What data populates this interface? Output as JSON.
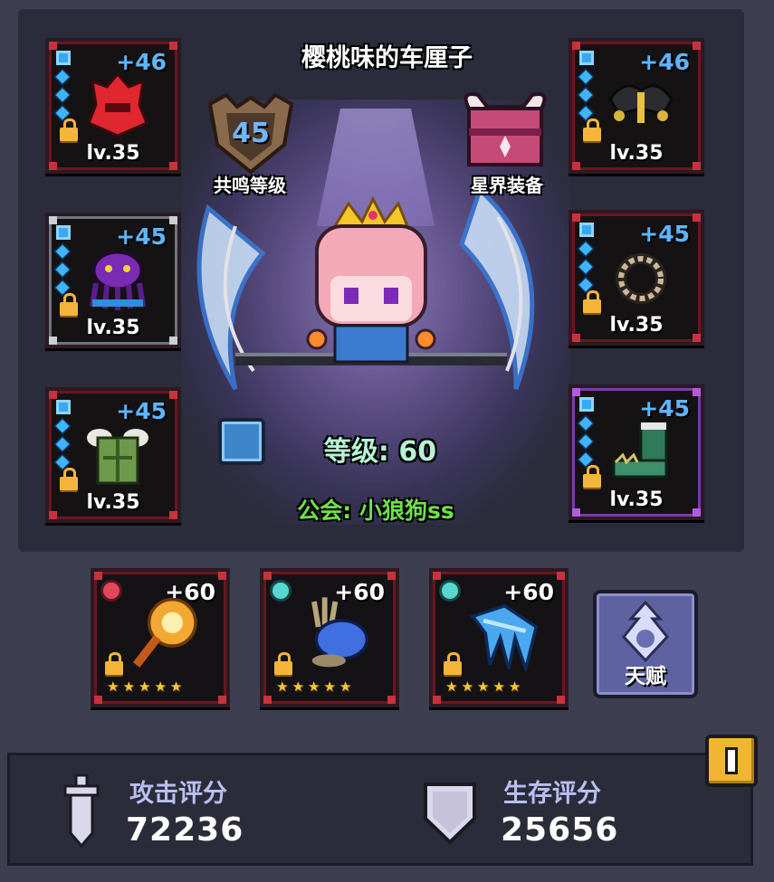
{
  "player": {
    "name": "樱桃味的车厘子",
    "level_text": "等级: 60",
    "guild_text": "公会: 小狼狗ss"
  },
  "badges": {
    "resonance": {
      "value": "45",
      "label": "共鸣等级",
      "icon": "resonance-crest-icon"
    },
    "astral": {
      "label": "星界装备",
      "icon": "astral-chest-icon"
    }
  },
  "equipment_left": [
    {
      "name": "helmet",
      "plus": "+46",
      "level": "lv.35",
      "icon": "red-helmet-icon",
      "frame": "red"
    },
    {
      "name": "pendant",
      "plus": "+45",
      "level": "lv.35",
      "icon": "purple-squid-amulet-icon",
      "frame": "gray"
    },
    {
      "name": "armor",
      "plus": "+45",
      "level": "lv.35",
      "icon": "green-armor-icon",
      "frame": "red"
    }
  ],
  "equipment_right": [
    {
      "name": "shoulder",
      "plus": "+46",
      "level": "lv.35",
      "icon": "dark-shoulder-guard-icon",
      "frame": "red"
    },
    {
      "name": "ring",
      "plus": "+45",
      "level": "lv.35",
      "icon": "ring-icon",
      "frame": "red"
    },
    {
      "name": "boots",
      "plus": "+45",
      "level": "lv.35",
      "icon": "green-boots-icon",
      "frame": "purple"
    }
  ],
  "weapons": [
    {
      "plus": "+60",
      "stars": "★★★★★",
      "icon": "golden-mace-icon",
      "element": "fire"
    },
    {
      "plus": "+60",
      "stars": "★★★★★",
      "icon": "blue-orb-staff-icon",
      "element": "ice"
    },
    {
      "plus": "+60",
      "stars": "★★★★★",
      "icon": "ice-claw-icon",
      "element": "ice"
    }
  ],
  "talent": {
    "label": "天赋",
    "icon": "talent-crest-icon"
  },
  "stats": {
    "attack": {
      "label": "攻击评分",
      "value": "72236",
      "icon": "sword-icon"
    },
    "survival": {
      "label": "生存评分",
      "value": "25656",
      "icon": "shield-icon"
    }
  },
  "colors": {
    "plus_blue": "#5eb6ff",
    "guild_green": "#6fe04a",
    "level_mint": "#b6f2d4",
    "frame_red": "#6b1620",
    "frame_purple": "#7a3aa8",
    "info_yellow": "#f0b531"
  }
}
